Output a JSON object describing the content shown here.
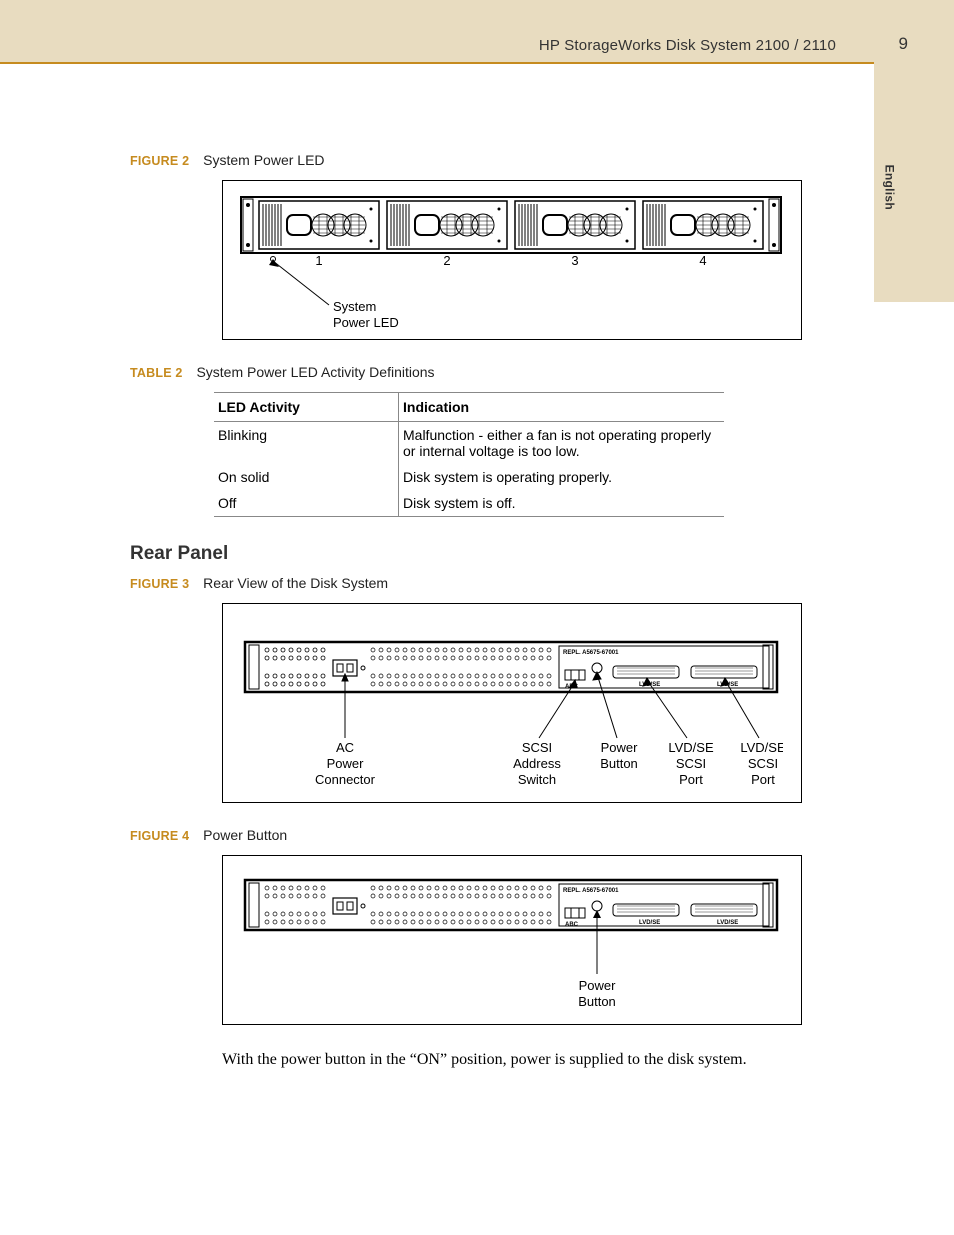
{
  "header": {
    "doc_title": "HP  StorageWorks Disk System 2100 / 2110",
    "page_number": "9"
  },
  "side_tab": {
    "language": "English"
  },
  "figure2": {
    "label": "FIGURE 2",
    "caption": "System Power LED",
    "callout": "System\nPower LED",
    "slot_numbers": [
      "1",
      "2",
      "3",
      "4"
    ]
  },
  "table2": {
    "label": "TABLE 2",
    "caption": "System Power LED Activity Definitions",
    "headers": [
      "LED Activity",
      "Indication"
    ],
    "rows": [
      {
        "activity": "Blinking",
        "indication": "Malfunction -  either a fan is not operating properly or internal voltage is too low."
      },
      {
        "activity": "On solid",
        "indication": "Disk system is operating properly."
      },
      {
        "activity": "Off",
        "indication": "Disk system is off."
      }
    ]
  },
  "section_rear_panel": {
    "heading": "Rear Panel"
  },
  "figure3": {
    "label": "FIGURE 3",
    "caption": "Rear View of the Disk System",
    "callouts": {
      "ac_power": "AC\nPower\nConnector",
      "scsi_addr": "SCSI\nAddress\nSwitch",
      "power_btn": "Power\nButton",
      "lvdse1": "LVD/SE\nSCSI\nPort",
      "lvdse2": "LVD/SE\nSCSI\nPort"
    },
    "panel_labels": {
      "repl": "REPL. A5675-67001",
      "abc": "ABC",
      "lvdse": "LVD/SE"
    }
  },
  "figure4": {
    "label": "FIGURE 4",
    "caption": "Power Button",
    "callout": "Power\nButton",
    "panel_labels": {
      "repl": "REPL. A5675-67001",
      "abc": "ABC",
      "lvdse": "LVD/SE"
    }
  },
  "body_text": {
    "power_button_para": "With the power button in the “ON” position, power is supplied to the disk system."
  }
}
